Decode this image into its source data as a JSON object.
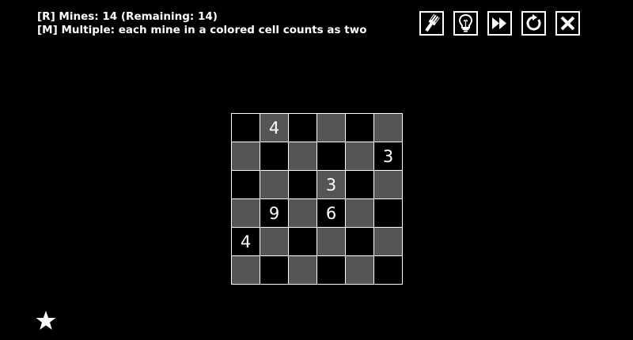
{
  "rules": {
    "line1": "[R] Mines: 14 (Remaining: 14)",
    "line2": "[M] Multiple: each mine in a colored cell counts as two"
  },
  "toolbar": {
    "buttons": [
      {
        "name": "brush-button",
        "icon": "brush-icon"
      },
      {
        "name": "hint-button",
        "icon": "lightbulb-icon"
      },
      {
        "name": "skip-button",
        "icon": "fast-forward-icon"
      },
      {
        "name": "restart-button",
        "icon": "restart-icon"
      },
      {
        "name": "close-button",
        "icon": "close-icon"
      }
    ]
  },
  "colors": {
    "background": "#000000",
    "colored_cell": "#555555",
    "uncolored_cell": "#000000",
    "foreground": "#ffffff"
  },
  "board": {
    "rows": 6,
    "cols": 6,
    "cells": [
      [
        {
          "c": "black",
          "v": ""
        },
        {
          "c": "gray",
          "v": "4"
        },
        {
          "c": "black",
          "v": ""
        },
        {
          "c": "gray",
          "v": ""
        },
        {
          "c": "black",
          "v": ""
        },
        {
          "c": "gray",
          "v": ""
        }
      ],
      [
        {
          "c": "gray",
          "v": ""
        },
        {
          "c": "black",
          "v": ""
        },
        {
          "c": "gray",
          "v": ""
        },
        {
          "c": "black",
          "v": ""
        },
        {
          "c": "gray",
          "v": ""
        },
        {
          "c": "black",
          "v": "3"
        }
      ],
      [
        {
          "c": "black",
          "v": ""
        },
        {
          "c": "gray",
          "v": ""
        },
        {
          "c": "black",
          "v": ""
        },
        {
          "c": "gray",
          "v": "3"
        },
        {
          "c": "black",
          "v": ""
        },
        {
          "c": "gray",
          "v": ""
        }
      ],
      [
        {
          "c": "gray",
          "v": ""
        },
        {
          "c": "black",
          "v": "9"
        },
        {
          "c": "gray",
          "v": ""
        },
        {
          "c": "black",
          "v": "6"
        },
        {
          "c": "gray",
          "v": ""
        },
        {
          "c": "black",
          "v": ""
        }
      ],
      [
        {
          "c": "black",
          "v": "4"
        },
        {
          "c": "gray",
          "v": ""
        },
        {
          "c": "black",
          "v": ""
        },
        {
          "c": "gray",
          "v": ""
        },
        {
          "c": "black",
          "v": ""
        },
        {
          "c": "gray",
          "v": ""
        }
      ],
      [
        {
          "c": "gray",
          "v": ""
        },
        {
          "c": "black",
          "v": ""
        },
        {
          "c": "gray",
          "v": ""
        },
        {
          "c": "black",
          "v": ""
        },
        {
          "c": "gray",
          "v": ""
        },
        {
          "c": "black",
          "v": ""
        }
      ]
    ]
  },
  "footer": {
    "icon": "star-icon"
  }
}
